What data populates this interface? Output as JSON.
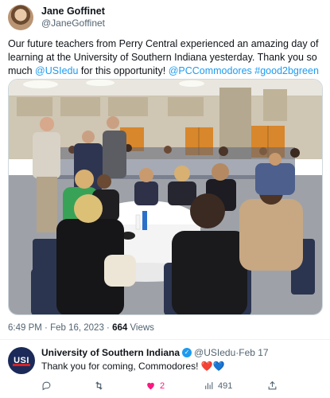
{
  "author": {
    "display_name": "Jane Goffinet",
    "handle": "@JaneGoffinet"
  },
  "tweet": {
    "text_part1": "Our future teachers from Perry Central experienced an amazing day of learning at the University of Southern Indiana yesterday. Thank you so much ",
    "mention1": "@USIedu",
    "text_part2": " for this opportunity! ",
    "mention2": "@PCCommodores",
    "hashtag": "#good2bgreen"
  },
  "meta": {
    "time": "6:49 PM",
    "separator": " · ",
    "date": "Feb 16, 2023",
    "views_count": "664",
    "views_label": " Views"
  },
  "reply": {
    "avatar_text": "USI",
    "display_name": "University of Southern Indiana",
    "handle": "@USIedu",
    "separator": " · ",
    "date": "Feb 17",
    "text": "Thank you for coming, Commodores! ",
    "heart_red": "❤️",
    "heart_blue": "💙",
    "actions": {
      "reply_icon": "reply-icon",
      "retweet_icon": "retweet-icon",
      "like_icon": "heart-icon",
      "like_count": "2",
      "views_icon": "views-icon",
      "views_count": "491",
      "share_icon": "share-icon"
    }
  },
  "colors": {
    "accent": "#1d9bf0",
    "like": "#f91880",
    "usi_navy": "#1b2a58",
    "usi_red": "#d2232a"
  }
}
